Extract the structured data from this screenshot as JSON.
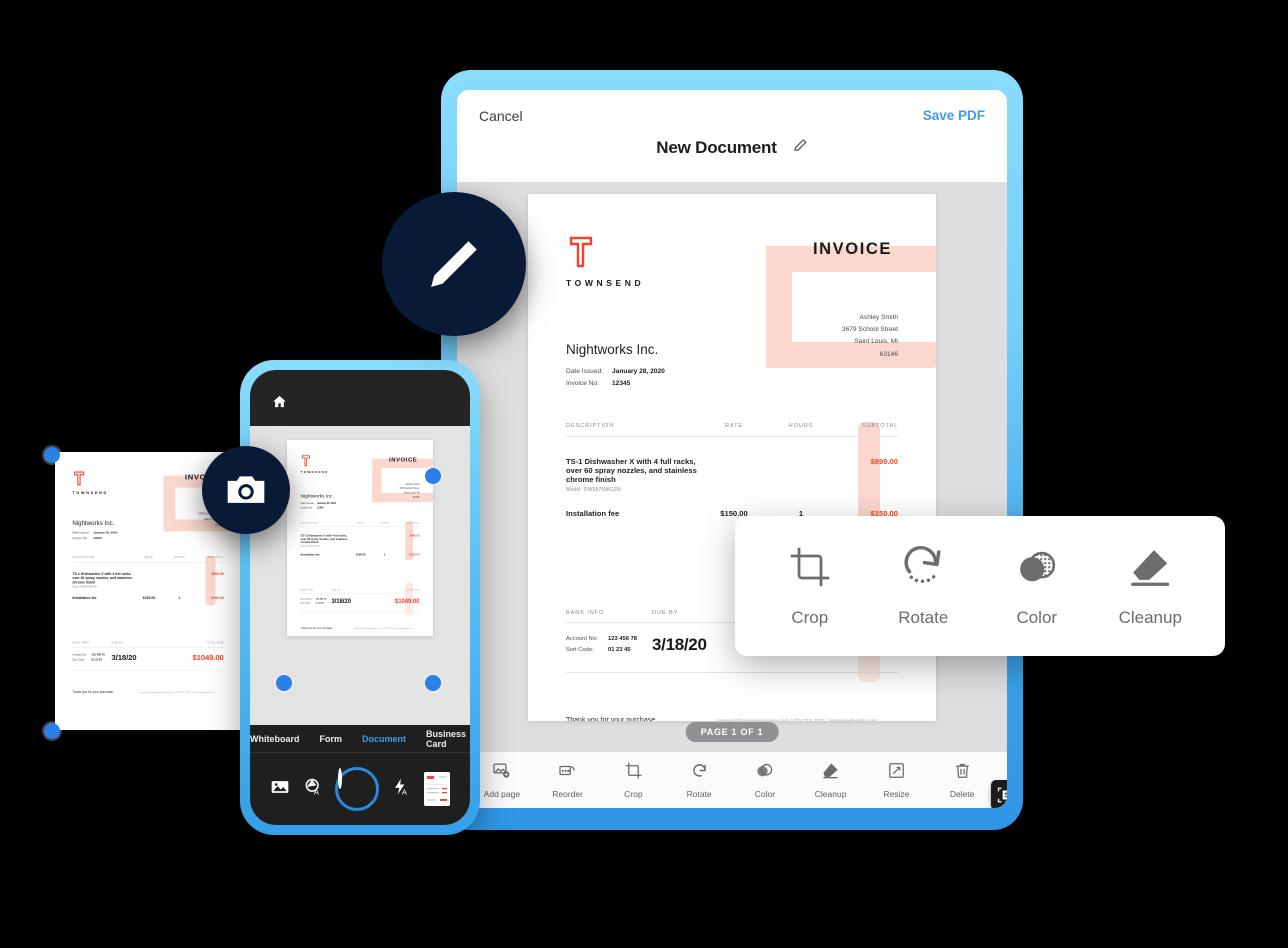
{
  "tablet": {
    "cancel_label": "Cancel",
    "save_label": "Save PDF",
    "doc_title": "New Document",
    "edit_icon": "pencil-icon",
    "page_indicator": "PAGE 1 OF 1",
    "toolbar": [
      {
        "label": "Add page",
        "icon": "add-page-icon"
      },
      {
        "label": "Reorder",
        "icon": "reorder-icon"
      },
      {
        "label": "Crop",
        "icon": "crop-icon"
      },
      {
        "label": "Rotate",
        "icon": "rotate-icon"
      },
      {
        "label": "Color",
        "icon": "color-icon"
      },
      {
        "label": "Cleanup",
        "icon": "cleanup-icon"
      },
      {
        "label": "Resize",
        "icon": "resize-icon"
      },
      {
        "label": "Delete",
        "icon": "trash-icon"
      }
    ],
    "scan_badge_icon": "scan-document-icon"
  },
  "float_menu": [
    {
      "label": "Crop",
      "icon": "crop-icon"
    },
    {
      "label": "Rotate",
      "icon": "rotate-icon"
    },
    {
      "label": "Color",
      "icon": "color-icon"
    },
    {
      "label": "Cleanup",
      "icon": "eraser-icon"
    }
  ],
  "phone": {
    "home_icon": "home-icon",
    "modes": [
      {
        "label": "Whiteboard",
        "active": false
      },
      {
        "label": "Form",
        "active": false
      },
      {
        "label": "Document",
        "active": true
      },
      {
        "label": "Business Card",
        "active": false
      }
    ],
    "controls": [
      {
        "icon": "gallery-icon"
      },
      {
        "icon": "auto-capture-icon"
      },
      {
        "icon": "shutter-button"
      },
      {
        "icon": "flash-auto-icon"
      },
      {
        "icon": "last-scan-thumbnail"
      }
    ]
  },
  "badges": [
    {
      "icon": "pencil-icon"
    },
    {
      "icon": "camera-icon"
    }
  ],
  "invoice": {
    "brand": "TOWNSEND",
    "brand_mark": "townsend-t-logo",
    "heading": "INVOICE",
    "client": "Nightworks Inc.",
    "date_label": "Date Issued:",
    "date_value": "January 28, 2020",
    "number_label": "Invoice No:",
    "number_value": "12345",
    "bill_to": [
      "Ashley Smith",
      "3679  School Street",
      "Saint Louis, MI",
      "63146"
    ],
    "columns": [
      "DESCRIPTION",
      "RATE",
      "HOURS",
      "SUBTOTAL"
    ],
    "items": [
      {
        "desc": "TS-1 Dishwasher X with 4 full racks,\nover 60 spray nozzles, and stainless\nchrome finish",
        "model": "Model: DW5876WGSN",
        "rate": "",
        "hours": "",
        "subtotal": "$899.00"
      },
      {
        "desc": "Installation fee",
        "model": "",
        "rate": "$150.00",
        "hours": "1",
        "subtotal": "$150.00"
      }
    ],
    "pay_columns": [
      "BANK INFO",
      "DUE BY",
      "TOTAL DUE"
    ],
    "account_label": "Account No:",
    "account_value": "123 456 78",
    "sort_label": "Sort Code:",
    "sort_value": "01 23 45",
    "due_by": "3/18/20",
    "total_due": "$1049.00",
    "thanks": "Thank you for your purchase.",
    "contact": "payment@townsendsupply.com   |   415.215.2021   |   townsendsupply.com"
  },
  "colors": {
    "accent_blue": "#3d9bea",
    "frame_blue_top": "#8ADCFB",
    "frame_blue_bottom": "#2E96E4",
    "invoice_red": "#f4422e",
    "invoice_pink": "#fbd7ce",
    "badge_navy": "#081a36",
    "handle_blue": "#2a7fe8"
  }
}
